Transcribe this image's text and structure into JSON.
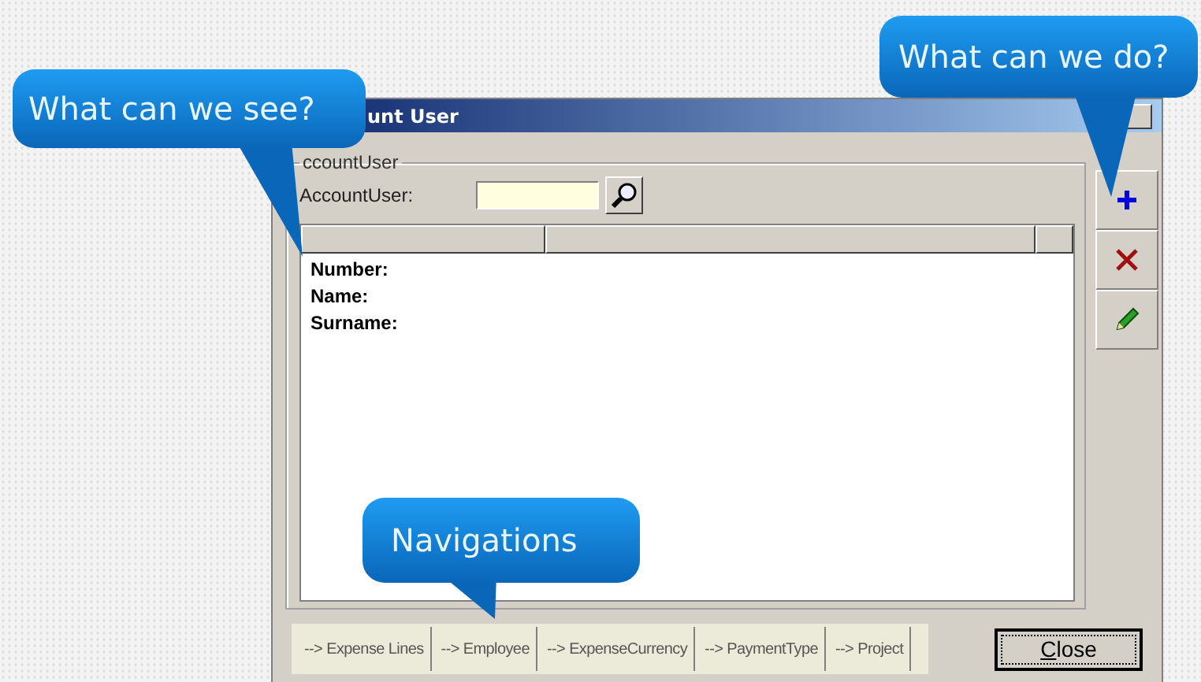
{
  "window": {
    "title": "unt User"
  },
  "filter": {
    "group_label": "ccountUser",
    "field_label": "AccountUser:"
  },
  "details": [
    "Number:",
    "Name:",
    "Surname:"
  ],
  "actions": [
    {
      "kind": "add"
    },
    {
      "kind": "delete"
    },
    {
      "kind": "edit"
    }
  ],
  "navigation": [
    {
      "arrow": "-->",
      "label": "Expense Lines"
    },
    {
      "arrow": "-->",
      "label": "Employee"
    },
    {
      "arrow": "-->",
      "label": "ExpenseCurrency"
    },
    {
      "arrow": "-->",
      "label": "PaymentType"
    },
    {
      "arrow": "-->",
      "label": "Project"
    }
  ],
  "close_button": "Close",
  "callouts": [
    {
      "text": "What can we see?"
    },
    {
      "text": "What can we do?"
    },
    {
      "text": "Navigations"
    }
  ]
}
